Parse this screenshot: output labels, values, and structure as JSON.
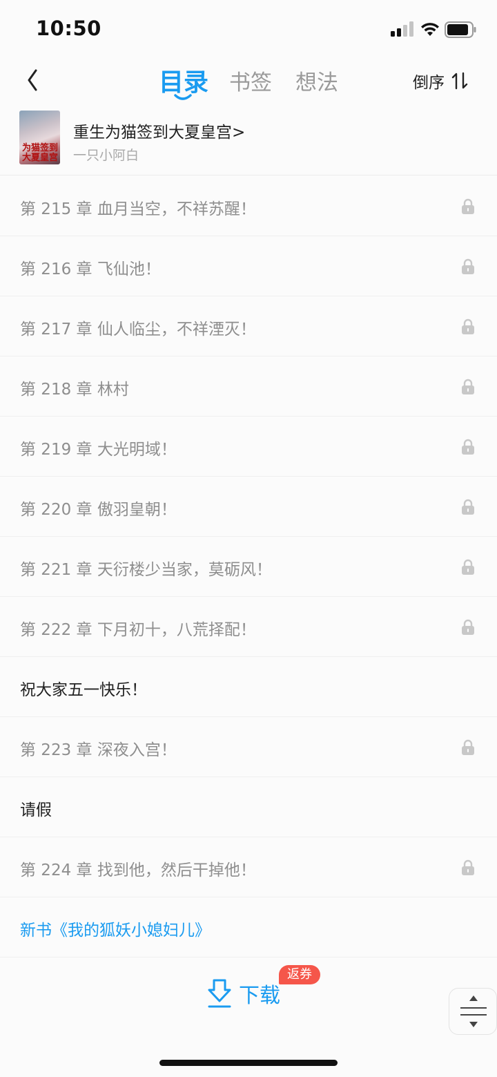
{
  "status_bar": {
    "time": "10:50"
  },
  "nav": {
    "tabs": [
      {
        "label": "目录",
        "active": true
      },
      {
        "label": "书签",
        "active": false
      },
      {
        "label": "想法",
        "active": false
      }
    ],
    "order_label": "倒序"
  },
  "book": {
    "title": "重生为猫签到大夏皇宫>",
    "author": "一只小阿白",
    "cover_text": "为猫签到大夏皇宫"
  },
  "chapters": [
    {
      "label": "第 215 章  血月当空，不祥苏醒！",
      "locked": true
    },
    {
      "label": "第 216 章  飞仙池！",
      "locked": true
    },
    {
      "label": "第 217 章  仙人临尘，不祥湮灭！",
      "locked": true
    },
    {
      "label": "第 218 章  林村",
      "locked": true
    },
    {
      "label": "第 219 章  大光明域！",
      "locked": true
    },
    {
      "label": "第 220 章  傲羽皇朝！",
      "locked": true
    },
    {
      "label": "第 221 章  天衍楼少当家，莫砺风！",
      "locked": true
    },
    {
      "label": "第 222 章  下月初十，八荒择配！",
      "locked": true
    },
    {
      "label": "祝大家五一快乐！",
      "locked": false
    },
    {
      "label": "第 223 章  深夜入宫！",
      "locked": true
    },
    {
      "label": "请假",
      "locked": false
    },
    {
      "label": "第 224 章  找到他，然后干掉他！",
      "locked": true
    },
    {
      "label": "新书《我的狐妖小媳妇儿》",
      "locked": false,
      "link": true
    }
  ],
  "bottom": {
    "download_label": "下载",
    "coupon_badge": "返券"
  },
  "colors": {
    "accent": "#1a9bf0",
    "badge": "#f5564a",
    "muted_text": "#8e8e8e"
  }
}
